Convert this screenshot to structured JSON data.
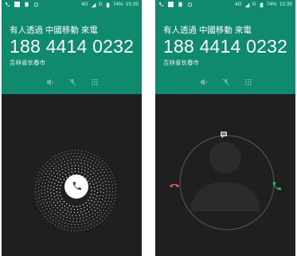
{
  "status_bar": {
    "network": "4G",
    "signal_label": "G",
    "battery": "74%",
    "time": "15:35"
  },
  "call": {
    "caller_line": "有人透過 中國移動 來電",
    "number": "188 4414 0232",
    "location": "吉林省长春市"
  },
  "icons": {
    "speaker": "speaker-icon",
    "mute": "mic-mute-icon",
    "dialpad": "dialpad-icon",
    "answer": "phone-icon",
    "message": "message-icon",
    "decline": "decline-icon",
    "accept": "accept-icon"
  },
  "colors": {
    "header_green": "#0f8a6f",
    "body_dark": "#1f1f1f",
    "decline_red": "#ff5a55",
    "accept_green": "#1cbf5a"
  }
}
